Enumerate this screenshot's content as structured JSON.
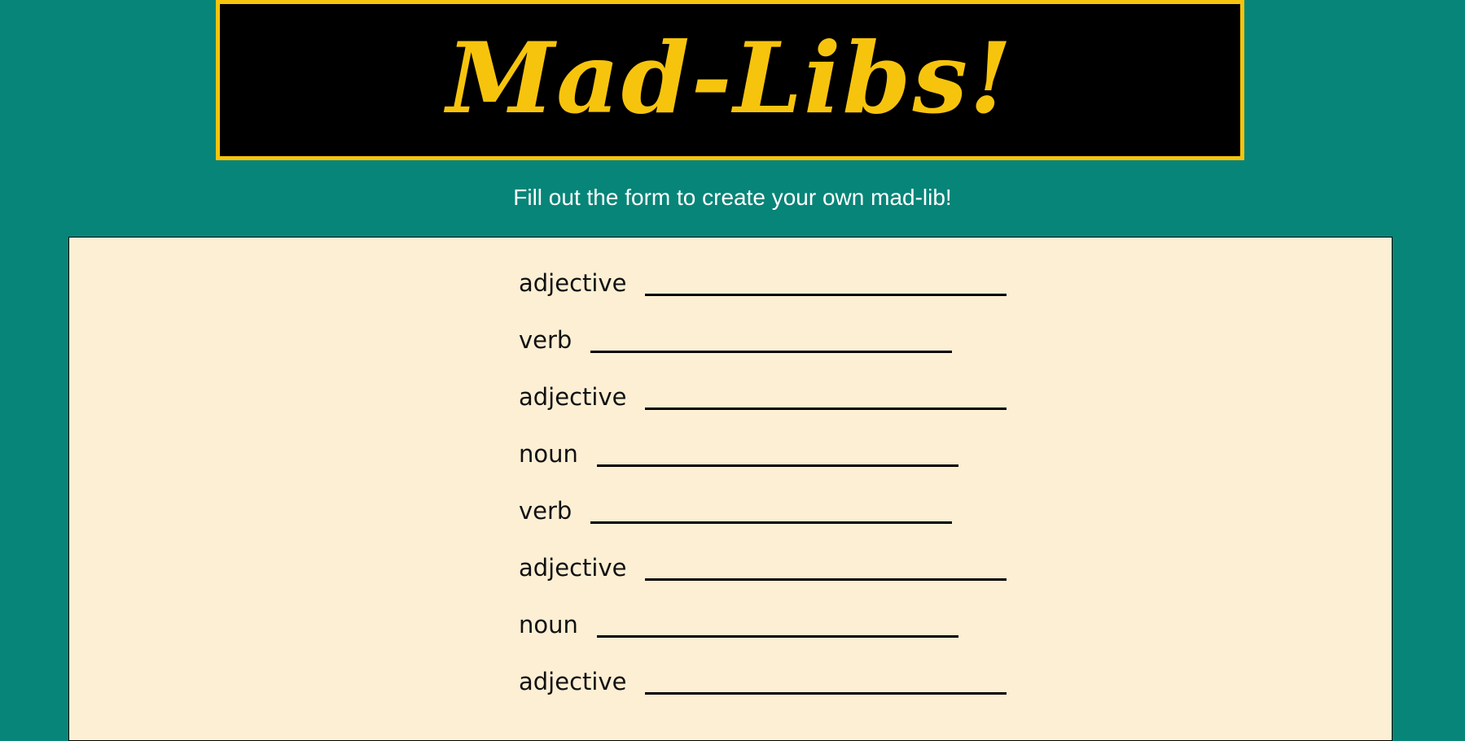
{
  "header": {
    "title": "Mad-Libs!"
  },
  "subtitle": "Fill out the form to create your own mad-lib!",
  "form": {
    "fields": [
      {
        "label": "adjective",
        "value": ""
      },
      {
        "label": "verb",
        "value": ""
      },
      {
        "label": "adjective",
        "value": ""
      },
      {
        "label": "noun",
        "value": ""
      },
      {
        "label": "verb",
        "value": ""
      },
      {
        "label": "adjective",
        "value": ""
      },
      {
        "label": "noun",
        "value": ""
      },
      {
        "label": "adjective",
        "value": ""
      }
    ]
  },
  "colors": {
    "background": "#078578",
    "accent": "#f7c40d",
    "banner": "#000000",
    "panel": "#fdefd4"
  }
}
